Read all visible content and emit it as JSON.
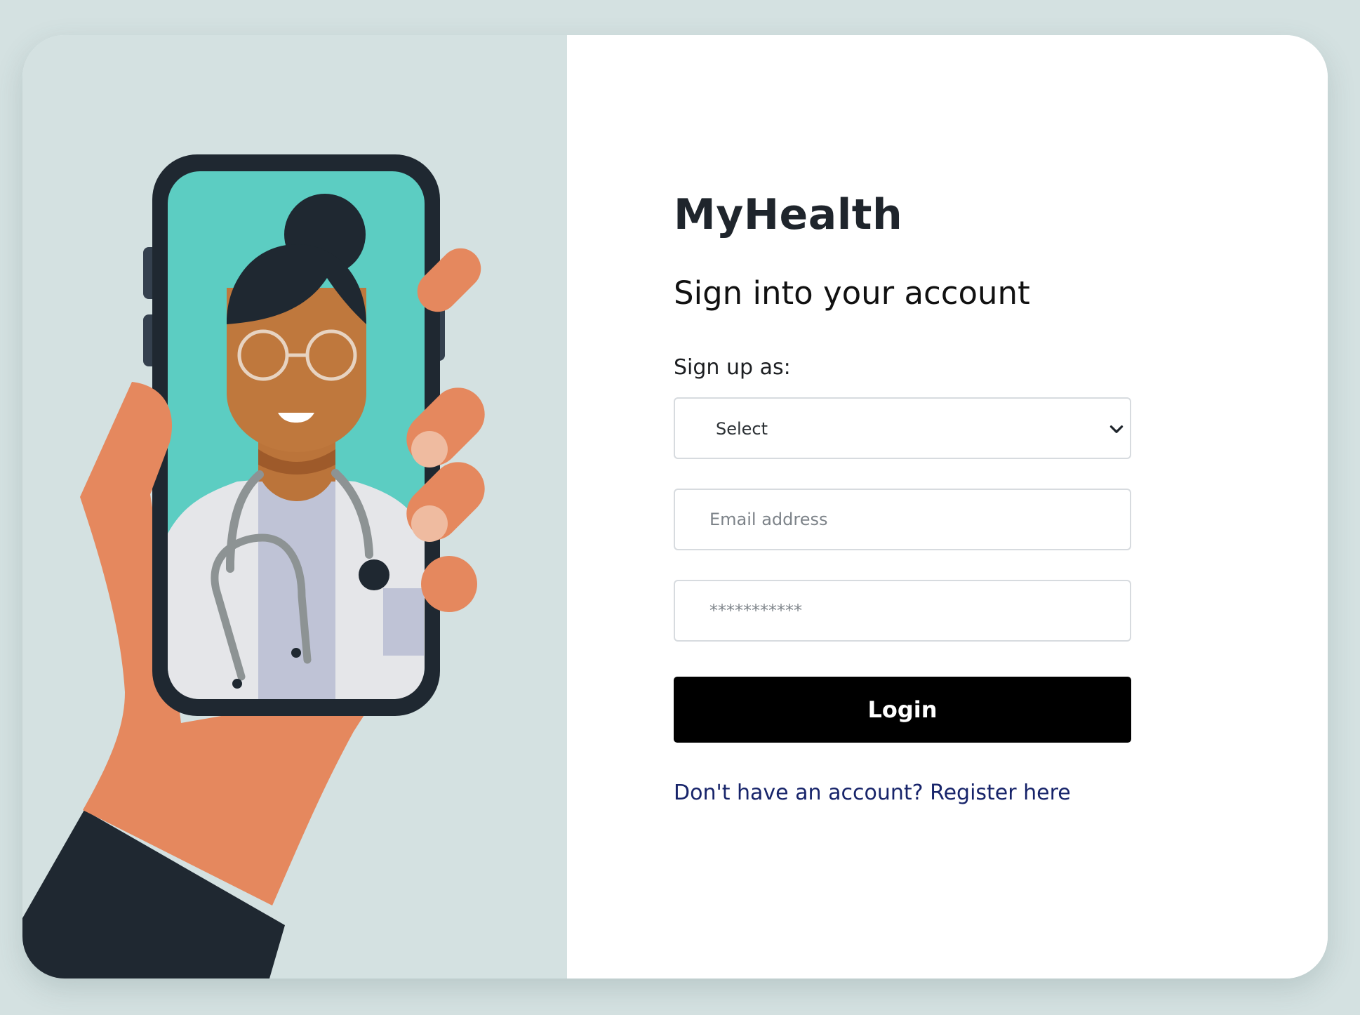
{
  "app": {
    "title": "MyHealth"
  },
  "login_form": {
    "heading": "Sign into your account",
    "role_label": "Sign up as:",
    "role_select_value": "Select",
    "email_placeholder": "Email address",
    "password_placeholder": "***********",
    "login_label": "Login",
    "register_link": "Don't have an account? Register here"
  },
  "illustration": {
    "subject": "hand-holding-phone-with-doctor-icon"
  },
  "icons": {
    "dropdown": "chevron-down-icon"
  },
  "colors": {
    "page_background": "#d4e1e1",
    "card_background": "#ffffff",
    "title_text": "#1f252c",
    "link": "#17246a",
    "button": "#000000",
    "button_text": "#ffffff",
    "phone_screen": "#5ccdc2",
    "hand": "#e5885e"
  }
}
